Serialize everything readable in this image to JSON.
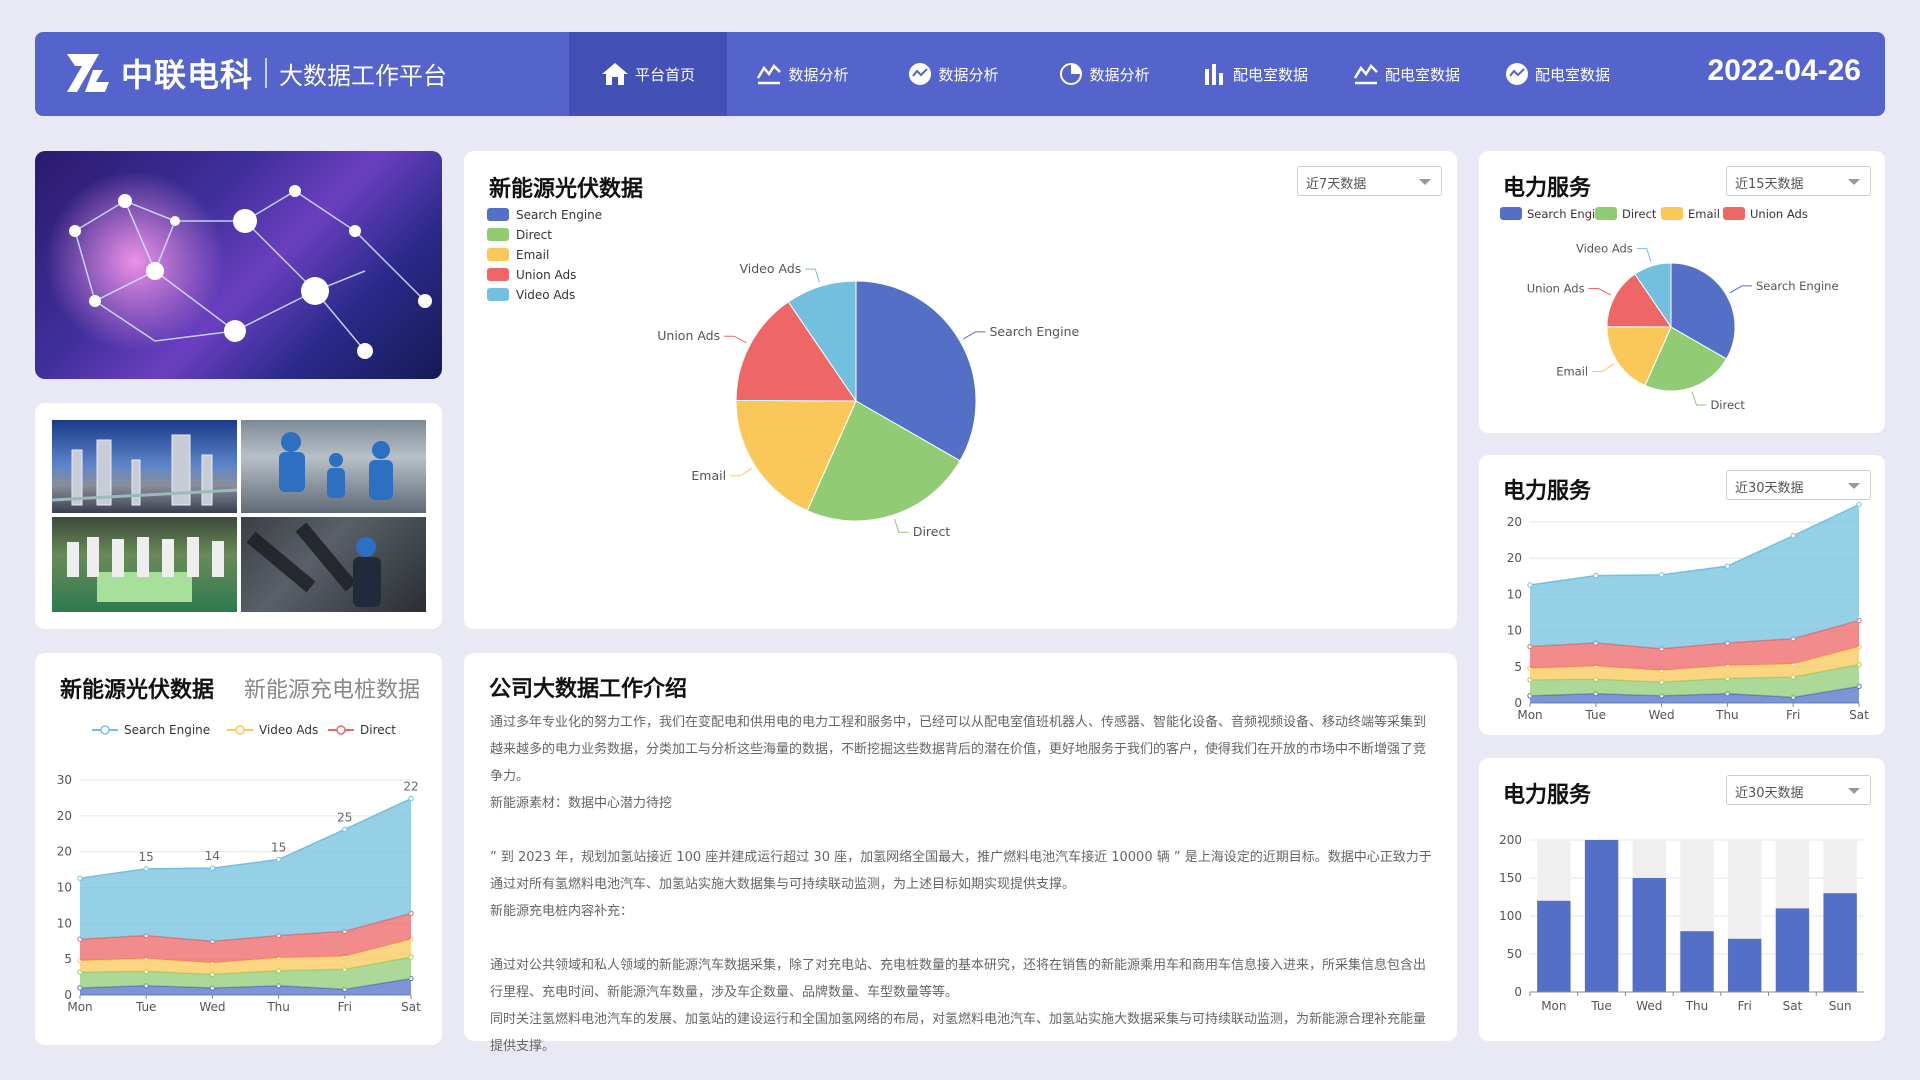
{
  "header": {
    "brand": "中联电科",
    "subtitle": "大数据工作平台",
    "date": "2022-04-26",
    "nav": [
      {
        "label": "平台首页",
        "icon": "home-icon",
        "active": true
      },
      {
        "label": "数据分析",
        "icon": "line-chart-icon"
      },
      {
        "label": "数据分析",
        "icon": "trend-circle-icon"
      },
      {
        "label": "数据分析",
        "icon": "pie-chart-icon"
      },
      {
        "label": "配电室数据",
        "icon": "bar-chart-icon"
      },
      {
        "label": "配电室数据",
        "icon": "line-chart-icon"
      },
      {
        "label": "配电室数据",
        "icon": "trend-circle-icon"
      }
    ]
  },
  "main_pie": {
    "title": "新能源光伏数据",
    "select": "近7天数据"
  },
  "bottom_left": {
    "title": "新能源光伏数据",
    "tab2": "新能源充电桩数据"
  },
  "intro": {
    "title": "公司大数据工作介绍",
    "paragraphs": [
      "通过多年专业化的努力工作，我们在变配电和供用电的电力工程和服务中，已经可以从配电室值班机器人、传感器、智能化设备、音频视频设备、移动终端等采集到越来越多的电力业务数据，分类加工与分析这些海量的数据，不断挖掘这些数据背后的潜在价值，更好地服务于我们的客户，使得我们在开放的市场中不断增强了竞争力。",
      "新能源素材：数据中心潜力待挖",
      "",
      "” 到 2023 年，规划加氢站接近 100 座并建成运行超过 30 座，加氢网络全国最大，推广燃料电池汽车接近 10000 辆 ” 是上海设定的近期目标。数据中心正致力于通过对所有氢燃料电池汽车、加氢站实施大数据集与可持续联动监测，为上述目标如期实现提供支撑。",
      "新能源充电桩内容补充：",
      "",
      "通过对公共领域和私人领域的新能源汽车数据采集，除了对充电站、充电桩数量的基本研究，还将在销售的新能源乘用车和商用车信息接入进来，所采集信息包含出行里程、充电时间、新能源汽车数量，涉及车企数量、品牌数量、车型数量等等。",
      "同时关注氢燃料电池汽车的发展、加氢站的建设运行和全国加氢网络的布局，对氢燃料电池汽车、加氢站实施大数据采集与可持续联动监测，为新能源合理补充能量提供支撑。"
    ]
  },
  "right_top": {
    "title": "电力服务",
    "select": "近15天数据"
  },
  "right_mid": {
    "title": "电力服务",
    "select": "近30天数据"
  },
  "right_bot": {
    "title": "电力服务",
    "select": "近30天数据"
  },
  "colors": {
    "blue": "#5470c6",
    "green": "#91cc75",
    "yellow": "#fac858",
    "red": "#ee6666",
    "cyan": "#73c0de",
    "header": "#5563cc"
  },
  "chart_data": [
    {
      "id": "main-pie",
      "type": "pie",
      "legend": [
        "Search Engine",
        "Direct",
        "Email",
        "Union Ads",
        "Video Ads"
      ],
      "slices": [
        {
          "label": "Search Engine",
          "value": 1048
        },
        {
          "label": "Direct",
          "value": 735
        },
        {
          "label": "Email",
          "value": 580
        },
        {
          "label": "Union Ads",
          "value": 484
        },
        {
          "label": "Video Ads",
          "value": 300
        }
      ]
    },
    {
      "id": "right-pie",
      "type": "pie",
      "legend": [
        "Search Engine",
        "Direct",
        "Email",
        "Union Ads"
      ],
      "slices": [
        {
          "label": "Search Engine",
          "value": 1048
        },
        {
          "label": "Direct",
          "value": 735
        },
        {
          "label": "Email",
          "value": 580
        },
        {
          "label": "Union Ads",
          "value": 484
        },
        {
          "label": "Video Ads",
          "value": 300
        }
      ]
    },
    {
      "id": "stacked-area-left",
      "type": "area",
      "legend": [
        "Search Engine",
        "Video Ads",
        "Direct"
      ],
      "categories": [
        "Mon",
        "Tue",
        "Wed",
        "Thu",
        "Fri",
        "Sat"
      ],
      "ylim": [
        0,
        30
      ],
      "yticks": [
        "0",
        "5",
        "10",
        "10",
        "20",
        "20",
        "30"
      ],
      "series": [
        {
          "name": "s1",
          "values": [
            1.0,
            1.3,
            1.0,
            1.3,
            0.8,
            2.3
          ]
        },
        {
          "name": "s2",
          "values": [
            2.2,
            2.0,
            1.9,
            2.1,
            2.8,
            3.0
          ]
        },
        {
          "name": "s3",
          "values": [
            1.6,
            1.8,
            1.6,
            1.8,
            1.8,
            2.5
          ]
        },
        {
          "name": "s4",
          "values": [
            3.0,
            3.2,
            3.0,
            3.1,
            3.5,
            3.6
          ]
        },
        {
          "name": "s5",
          "values": [
            8.5,
            9.3,
            10.2,
            10.6,
            14.2,
            16.0
          ]
        }
      ],
      "labels": [
        "",
        "15",
        "14",
        "15",
        "25",
        "22"
      ]
    },
    {
      "id": "stacked-area-right",
      "type": "area",
      "categories": [
        "Mon",
        "Tue",
        "Wed",
        "Thu",
        "Fri",
        "Sat"
      ],
      "ylim": [
        0,
        25
      ],
      "yticks": [
        "0",
        "5",
        "10",
        "10",
        "20",
        "20"
      ],
      "series": [
        {
          "name": "s1",
          "values": [
            1.0,
            1.3,
            1.0,
            1.3,
            0.8,
            2.3
          ]
        },
        {
          "name": "s2",
          "values": [
            2.2,
            2.0,
            1.9,
            2.1,
            2.8,
            3.0
          ]
        },
        {
          "name": "s3",
          "values": [
            1.6,
            1.8,
            1.6,
            1.8,
            1.8,
            2.5
          ]
        },
        {
          "name": "s4",
          "values": [
            3.0,
            3.2,
            3.0,
            3.1,
            3.5,
            3.6
          ]
        },
        {
          "name": "s5",
          "values": [
            8.5,
            9.3,
            10.2,
            10.6,
            14.2,
            16.0
          ]
        }
      ]
    },
    {
      "id": "bar-right",
      "type": "bar",
      "categories": [
        "Mon",
        "Tue",
        "Wed",
        "Thu",
        "Fri",
        "Sat",
        "Sun"
      ],
      "values": [
        120,
        200,
        150,
        80,
        70,
        110,
        130
      ],
      "ylim": [
        0,
        200
      ],
      "yticks": [
        "0",
        "50",
        "100",
        "150",
        "200"
      ]
    }
  ]
}
